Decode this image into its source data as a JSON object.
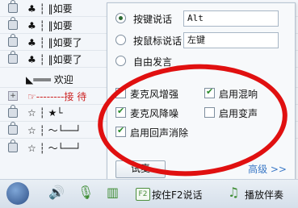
{
  "channel_rows": [
    {
      "icon": "lock",
      "text": "♣ ┆ ‖如要"
    },
    {
      "icon": "lock",
      "text": "♣ ┆ ‖如要"
    },
    {
      "icon": "lock",
      "text": "♣ ┆ ‖如要了"
    },
    {
      "icon": "lock",
      "text": "♣ ┆ ‖如要了"
    },
    {
      "icon": "none",
      "text": "◣═══ 欢迎"
    },
    {
      "icon": "plus",
      "text": "☞--------接 待"
    },
    {
      "icon": "lock",
      "text": "☆ ┆ ★└"
    },
    {
      "icon": "lock",
      "text": "☆ ┆ ～└──┘"
    },
    {
      "icon": "lock",
      "text": "☆ ┆ ～└──┘"
    }
  ],
  "popup": {
    "mode_hotkey_label": "按键说话",
    "hotkey_value": "Alt",
    "mode_mouse_label": "按鼠标说话",
    "mouse_value": "左键",
    "mode_free_label": "自由发言",
    "selected_mode": "hotkey",
    "options": {
      "mic_boost": {
        "label": "麦克风增强",
        "checked": true
      },
      "reverb": {
        "label": "启用混响",
        "checked": true
      },
      "noise_reduce": {
        "label": "麦克风降噪",
        "checked": true
      },
      "voice_change": {
        "label": "启用变声",
        "checked": false
      },
      "echo_cancel": {
        "label": "启用回声消除",
        "checked": true
      }
    },
    "test_mic_label": "试麦",
    "advanced_label": "高级 >>"
  },
  "bottom_bar": {
    "f2_label": "F2",
    "push_to_talk_label": "按住F2说话",
    "play_accompaniment_label": "播放伴奏"
  },
  "colors": {
    "annotation_red": "#e01010",
    "accent_green": "#3f8d35",
    "link_blue": "#3a78c6"
  }
}
